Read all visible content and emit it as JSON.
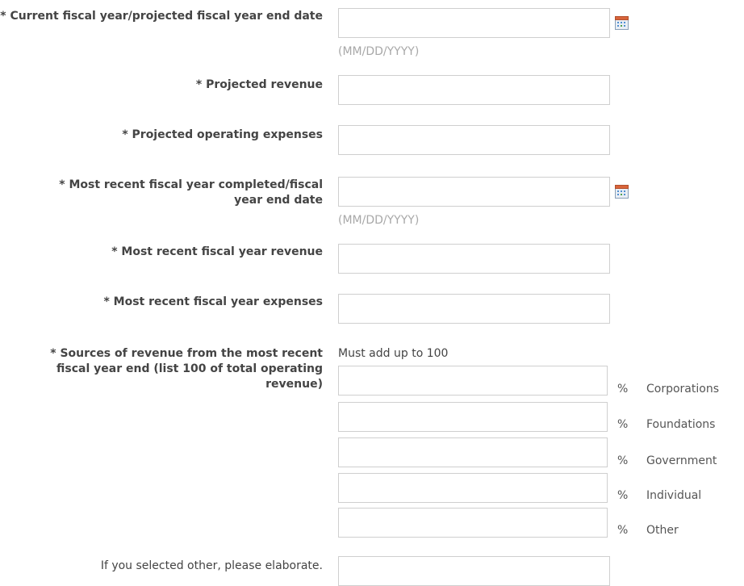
{
  "fields": {
    "current_fy_end": {
      "label": "* Current fiscal year/projected fiscal year end date",
      "value": "",
      "hint": "(MM/DD/YYYY)"
    },
    "projected_revenue": {
      "label": "* Projected revenue",
      "value": ""
    },
    "projected_expenses": {
      "label": "* Projected operating expenses",
      "value": ""
    },
    "recent_fy_end": {
      "label": "* Most recent fiscal year completed/fiscal year end date",
      "value": "",
      "hint": "(MM/DD/YYYY)"
    },
    "recent_revenue": {
      "label": "* Most recent fiscal year revenue",
      "value": ""
    },
    "recent_expenses": {
      "label": "* Most recent fiscal year expenses",
      "value": ""
    },
    "sources": {
      "label": "* Sources of revenue from the most recent fiscal year end (list 100 of total operating revenue)",
      "note": "Must add up to 100",
      "percent_symbol": "%",
      "items": [
        {
          "name": "Corporations",
          "value": ""
        },
        {
          "name": "Foundations",
          "value": ""
        },
        {
          "name": "Government",
          "value": ""
        },
        {
          "name": "Individual",
          "value": ""
        },
        {
          "name": "Other",
          "value": ""
        }
      ]
    },
    "other_elaborate": {
      "label": "If you selected other, please elaborate.",
      "value": ""
    }
  },
  "icons": {
    "calendar": "calendar-icon"
  },
  "colors": {
    "label_text": "#444444",
    "hint_text": "#a8a8a8",
    "input_border": "#cfcfcf",
    "calendar_accent": "#4f8fd1"
  }
}
